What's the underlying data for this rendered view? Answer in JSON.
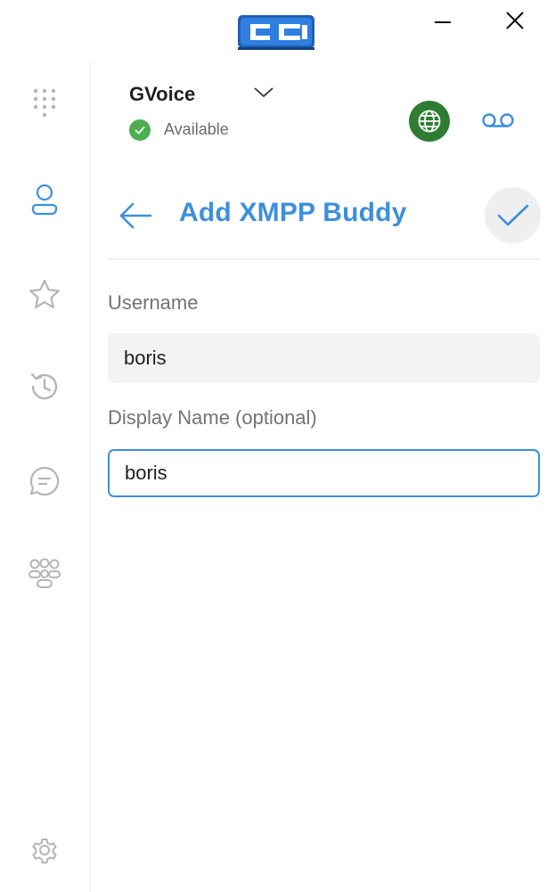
{
  "window": {
    "logo_icon": "cc-app-logo",
    "minimize_icon": "minimize-icon",
    "close_icon": "close-icon"
  },
  "sidebar": {
    "items": [
      {
        "name": "dialpad",
        "icon": "dialpad-icon"
      },
      {
        "name": "contacts",
        "icon": "contacts-icon",
        "active": true
      },
      {
        "name": "favorites",
        "icon": "star-icon"
      },
      {
        "name": "history",
        "icon": "history-icon"
      },
      {
        "name": "chat",
        "icon": "chat-icon"
      },
      {
        "name": "groups",
        "icon": "groups-icon"
      },
      {
        "name": "settings",
        "icon": "gear-icon"
      }
    ]
  },
  "account": {
    "name": "GVoice",
    "status": "Available",
    "status_color": "#4caf50",
    "globe_color": "#2e7d32"
  },
  "page": {
    "title": "Add XMPP Buddy",
    "accent_color": "#3d8fdb"
  },
  "form": {
    "username_label": "Username",
    "username_value": "boris",
    "display_name_label": "Display Name (optional)",
    "display_name_value": "boris"
  }
}
